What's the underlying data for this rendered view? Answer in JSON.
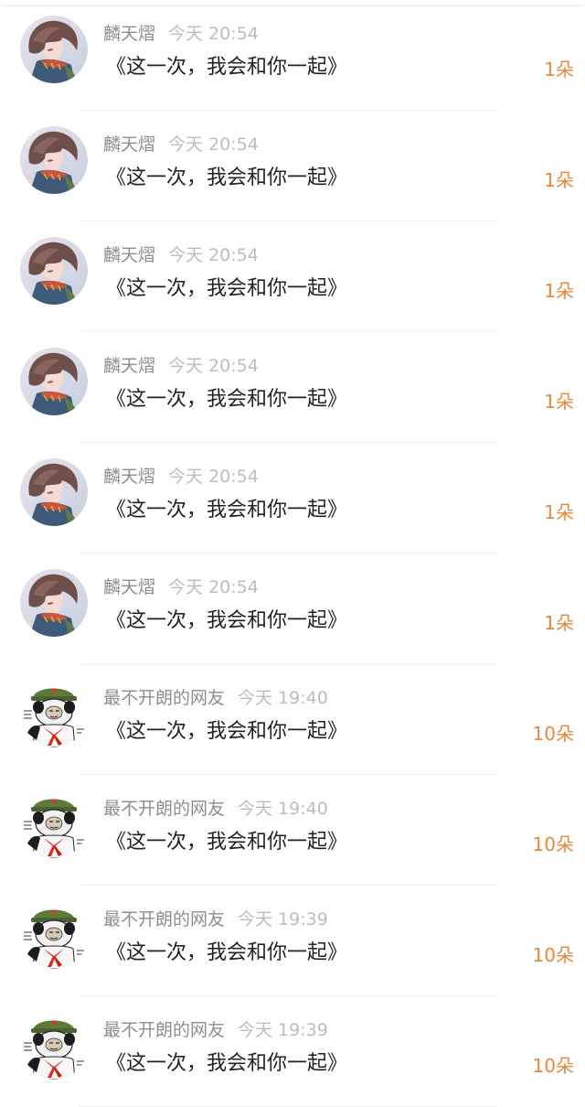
{
  "colors": {
    "username": "#8e8e8e",
    "time": "#bdbdbd",
    "message": "#222222",
    "gift": "#e8883a",
    "divider": "#f0f0f0"
  },
  "rows": [
    {
      "avatar": "anime-boy-avatar",
      "username": "麟天熠",
      "time": "今天 20:54",
      "message": "《这一次，我会和你一起》",
      "gift": "1朵"
    },
    {
      "avatar": "anime-boy-avatar",
      "username": "麟天熠",
      "time": "今天 20:54",
      "message": "《这一次，我会和你一起》",
      "gift": "1朵"
    },
    {
      "avatar": "anime-boy-avatar",
      "username": "麟天熠",
      "time": "今天 20:54",
      "message": "《这一次，我会和你一起》",
      "gift": "1朵"
    },
    {
      "avatar": "anime-boy-avatar",
      "username": "麟天熠",
      "time": "今天 20:54",
      "message": "《这一次，我会和你一起》",
      "gift": "1朵"
    },
    {
      "avatar": "anime-boy-avatar",
      "username": "麟天熠",
      "time": "今天 20:54",
      "message": "《这一次，我会和你一起》",
      "gift": "1朵"
    },
    {
      "avatar": "anime-boy-avatar",
      "username": "麟天熠",
      "time": "今天 20:54",
      "message": "《这一次，我会和你一起》",
      "gift": "1朵"
    },
    {
      "avatar": "panda-meme-avatar",
      "username": "最不开朗的网友",
      "time": "今天 19:40",
      "message": "《这一次，我会和你一起》",
      "gift": "10朵"
    },
    {
      "avatar": "panda-meme-avatar",
      "username": "最不开朗的网友",
      "time": "今天 19:40",
      "message": "《这一次，我会和你一起》",
      "gift": "10朵"
    },
    {
      "avatar": "panda-meme-avatar",
      "username": "最不开朗的网友",
      "time": "今天 19:39",
      "message": "《这一次，我会和你一起》",
      "gift": "10朵"
    },
    {
      "avatar": "panda-meme-avatar",
      "username": "最不开朗的网友",
      "time": "今天 19:39",
      "message": "《这一次，我会和你一起》",
      "gift": "10朵"
    }
  ]
}
